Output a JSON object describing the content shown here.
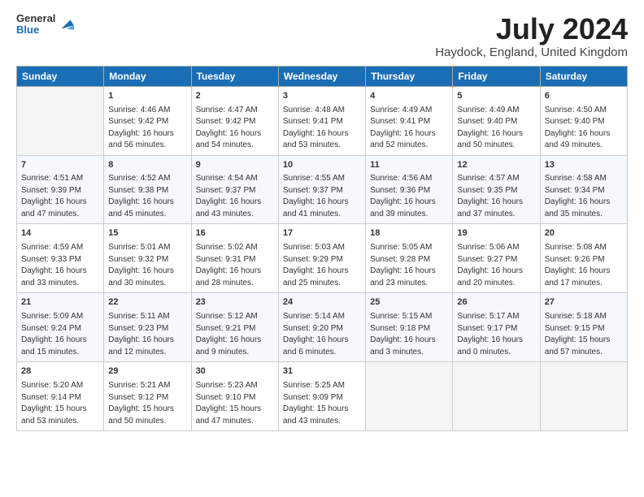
{
  "header": {
    "logo_line1": "General",
    "logo_line2": "Blue",
    "month_title": "July 2024",
    "location": "Haydock, England, United Kingdom"
  },
  "days_of_week": [
    "Sunday",
    "Monday",
    "Tuesday",
    "Wednesday",
    "Thursday",
    "Friday",
    "Saturday"
  ],
  "weeks": [
    [
      {
        "day": "",
        "info": ""
      },
      {
        "day": "1",
        "info": "Sunrise: 4:46 AM\nSunset: 9:42 PM\nDaylight: 16 hours\nand 56 minutes."
      },
      {
        "day": "2",
        "info": "Sunrise: 4:47 AM\nSunset: 9:42 PM\nDaylight: 16 hours\nand 54 minutes."
      },
      {
        "day": "3",
        "info": "Sunrise: 4:48 AM\nSunset: 9:41 PM\nDaylight: 16 hours\nand 53 minutes."
      },
      {
        "day": "4",
        "info": "Sunrise: 4:49 AM\nSunset: 9:41 PM\nDaylight: 16 hours\nand 52 minutes."
      },
      {
        "day": "5",
        "info": "Sunrise: 4:49 AM\nSunset: 9:40 PM\nDaylight: 16 hours\nand 50 minutes."
      },
      {
        "day": "6",
        "info": "Sunrise: 4:50 AM\nSunset: 9:40 PM\nDaylight: 16 hours\nand 49 minutes."
      }
    ],
    [
      {
        "day": "7",
        "info": "Sunrise: 4:51 AM\nSunset: 9:39 PM\nDaylight: 16 hours\nand 47 minutes."
      },
      {
        "day": "8",
        "info": "Sunrise: 4:52 AM\nSunset: 9:38 PM\nDaylight: 16 hours\nand 45 minutes."
      },
      {
        "day": "9",
        "info": "Sunrise: 4:54 AM\nSunset: 9:37 PM\nDaylight: 16 hours\nand 43 minutes."
      },
      {
        "day": "10",
        "info": "Sunrise: 4:55 AM\nSunset: 9:37 PM\nDaylight: 16 hours\nand 41 minutes."
      },
      {
        "day": "11",
        "info": "Sunrise: 4:56 AM\nSunset: 9:36 PM\nDaylight: 16 hours\nand 39 minutes."
      },
      {
        "day": "12",
        "info": "Sunrise: 4:57 AM\nSunset: 9:35 PM\nDaylight: 16 hours\nand 37 minutes."
      },
      {
        "day": "13",
        "info": "Sunrise: 4:58 AM\nSunset: 9:34 PM\nDaylight: 16 hours\nand 35 minutes."
      }
    ],
    [
      {
        "day": "14",
        "info": "Sunrise: 4:59 AM\nSunset: 9:33 PM\nDaylight: 16 hours\nand 33 minutes."
      },
      {
        "day": "15",
        "info": "Sunrise: 5:01 AM\nSunset: 9:32 PM\nDaylight: 16 hours\nand 30 minutes."
      },
      {
        "day": "16",
        "info": "Sunrise: 5:02 AM\nSunset: 9:31 PM\nDaylight: 16 hours\nand 28 minutes."
      },
      {
        "day": "17",
        "info": "Sunrise: 5:03 AM\nSunset: 9:29 PM\nDaylight: 16 hours\nand 25 minutes."
      },
      {
        "day": "18",
        "info": "Sunrise: 5:05 AM\nSunset: 9:28 PM\nDaylight: 16 hours\nand 23 minutes."
      },
      {
        "day": "19",
        "info": "Sunrise: 5:06 AM\nSunset: 9:27 PM\nDaylight: 16 hours\nand 20 minutes."
      },
      {
        "day": "20",
        "info": "Sunrise: 5:08 AM\nSunset: 9:26 PM\nDaylight: 16 hours\nand 17 minutes."
      }
    ],
    [
      {
        "day": "21",
        "info": "Sunrise: 5:09 AM\nSunset: 9:24 PM\nDaylight: 16 hours\nand 15 minutes."
      },
      {
        "day": "22",
        "info": "Sunrise: 5:11 AM\nSunset: 9:23 PM\nDaylight: 16 hours\nand 12 minutes."
      },
      {
        "day": "23",
        "info": "Sunrise: 5:12 AM\nSunset: 9:21 PM\nDaylight: 16 hours\nand 9 minutes."
      },
      {
        "day": "24",
        "info": "Sunrise: 5:14 AM\nSunset: 9:20 PM\nDaylight: 16 hours\nand 6 minutes."
      },
      {
        "day": "25",
        "info": "Sunrise: 5:15 AM\nSunset: 9:18 PM\nDaylight: 16 hours\nand 3 minutes."
      },
      {
        "day": "26",
        "info": "Sunrise: 5:17 AM\nSunset: 9:17 PM\nDaylight: 16 hours\nand 0 minutes."
      },
      {
        "day": "27",
        "info": "Sunrise: 5:18 AM\nSunset: 9:15 PM\nDaylight: 15 hours\nand 57 minutes."
      }
    ],
    [
      {
        "day": "28",
        "info": "Sunrise: 5:20 AM\nSunset: 9:14 PM\nDaylight: 15 hours\nand 53 minutes."
      },
      {
        "day": "29",
        "info": "Sunrise: 5:21 AM\nSunset: 9:12 PM\nDaylight: 15 hours\nand 50 minutes."
      },
      {
        "day": "30",
        "info": "Sunrise: 5:23 AM\nSunset: 9:10 PM\nDaylight: 15 hours\nand 47 minutes."
      },
      {
        "day": "31",
        "info": "Sunrise: 5:25 AM\nSunset: 9:09 PM\nDaylight: 15 hours\nand 43 minutes."
      },
      {
        "day": "",
        "info": ""
      },
      {
        "day": "",
        "info": ""
      },
      {
        "day": "",
        "info": ""
      }
    ]
  ]
}
